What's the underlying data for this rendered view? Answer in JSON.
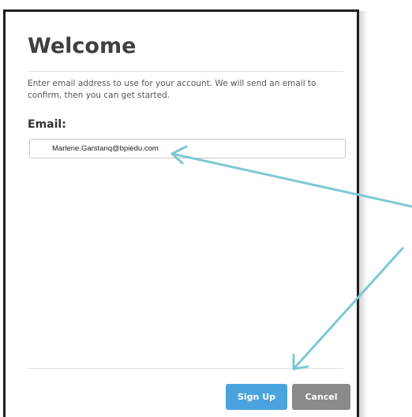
{
  "dialog": {
    "title": "Welcome",
    "intro": "Enter email address to use for your account. We will send an email to confirm, then you can get started.",
    "email_label": "Email:",
    "email_value": "Marlene.Garstanq@bpiedu.com",
    "signup_label": "Sign Up",
    "cancel_label": "Cancel"
  },
  "annotations": {
    "arrow_color": "#7ec8d3"
  }
}
